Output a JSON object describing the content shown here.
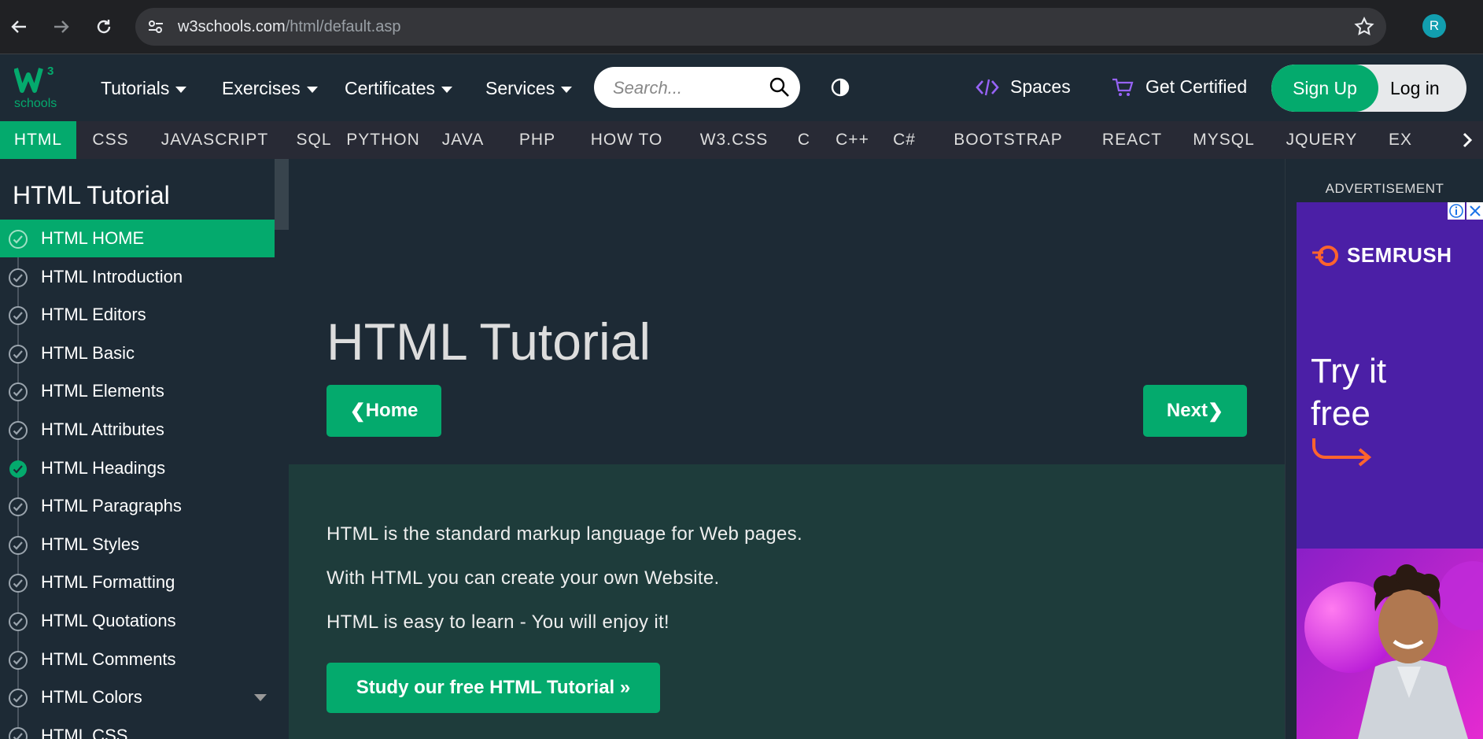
{
  "browser": {
    "url_host": "w3schools.com",
    "url_path": "/html/default.asp",
    "profile_initial": "R"
  },
  "topnav": {
    "logo_text": "schools",
    "logo_superscript": "3",
    "menus": [
      {
        "label": "Tutorials"
      },
      {
        "label": "Exercises"
      },
      {
        "label": "Certificates"
      },
      {
        "label": "Services"
      }
    ],
    "search_placeholder": "Search...",
    "spaces_label": "Spaces",
    "certified_label": "Get Certified",
    "signup_label": "Sign Up",
    "login_label": "Log in"
  },
  "subjects": [
    "HTML",
    "CSS",
    "JAVASCRIPT",
    "SQL",
    "PYTHON",
    "JAVA",
    "PHP",
    "HOW TO",
    "W3.CSS",
    "C",
    "C++",
    "C#",
    "BOOTSTRAP",
    "REACT",
    "MYSQL",
    "JQUERY",
    "EX"
  ],
  "active_subject": "HTML",
  "sidebar": {
    "title": "HTML Tutorial",
    "items": [
      {
        "label": "HTML HOME",
        "state": "active"
      },
      {
        "label": "HTML Introduction",
        "state": "default"
      },
      {
        "label": "HTML Editors",
        "state": "default"
      },
      {
        "label": "HTML Basic",
        "state": "default"
      },
      {
        "label": "HTML Elements",
        "state": "default"
      },
      {
        "label": "HTML Attributes",
        "state": "default"
      },
      {
        "label": "HTML Headings",
        "state": "completed"
      },
      {
        "label": "HTML Paragraphs",
        "state": "default"
      },
      {
        "label": "HTML Styles",
        "state": "default"
      },
      {
        "label": "HTML Formatting",
        "state": "default"
      },
      {
        "label": "HTML Quotations",
        "state": "default"
      },
      {
        "label": "HTML Comments",
        "state": "default"
      },
      {
        "label": "HTML Colors",
        "state": "default",
        "has_dropdown": true
      },
      {
        "label": "HTML CSS",
        "state": "default"
      }
    ]
  },
  "main": {
    "title": "HTML Tutorial",
    "prev_label": "Home",
    "next_label": "Next",
    "intro_lines": [
      "HTML is the standard markup language for Web pages.",
      "With HTML you can create your own Website.",
      "HTML is easy to learn - You will enjoy it!"
    ],
    "cta_label": "Study our free HTML Tutorial »"
  },
  "ad": {
    "label": "ADVERTISEMENT",
    "brand": "SEMRUSH",
    "tagline_1": "Try it",
    "tagline_2": "free"
  },
  "colors": {
    "brand_green": "#04aa6d",
    "page_bg": "#1d2a35",
    "intro_bg": "#1e3c3b",
    "subject_bar_bg": "#282a35",
    "ad_bg": "#4b1fa6"
  }
}
